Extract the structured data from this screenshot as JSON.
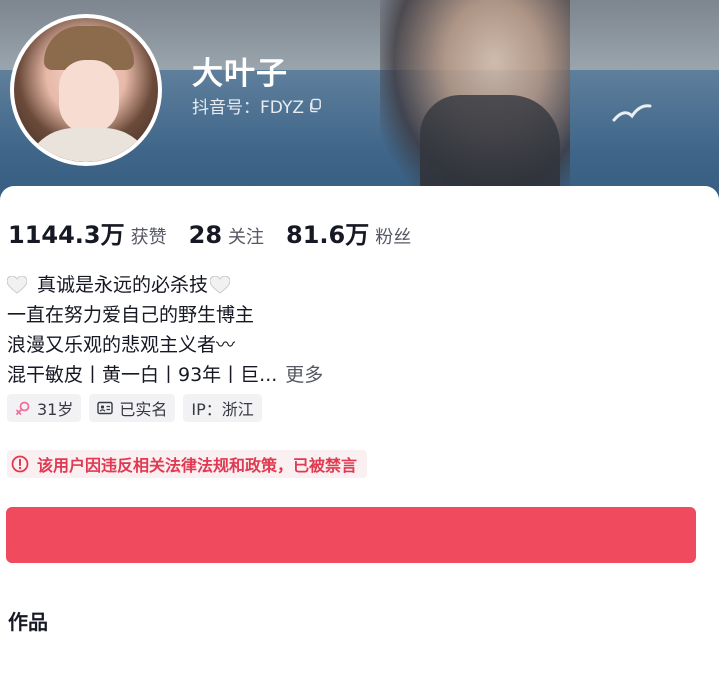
{
  "profile": {
    "name": "大叶子",
    "handle": "抖音号：FDYZ"
  },
  "stats": [
    {
      "value": "1144.3万",
      "label": "获赞"
    },
    {
      "value": "28",
      "label": "关注"
    },
    {
      "value": "81.6万",
      "label": "粉丝"
    }
  ],
  "bio": {
    "line1": "真诚是永远的必杀技",
    "line2": "一直在努力爱自己的野生博主",
    "line3": "浪漫又乐观的悲观主义者〰",
    "line4": "混干敏皮丨黄一白丨93年丨巨...",
    "more": "更多"
  },
  "tags": {
    "age": "31岁",
    "verified": "已实名",
    "ip": "IP：浙江"
  },
  "warning": "该用户因违反相关法律法规和政策，已被禁言",
  "sections": {
    "works": "作品"
  },
  "colors": {
    "accent": "#ef4a5e",
    "warning_text": "#e03a52",
    "warning_bg": "#fbf0f1"
  },
  "icons": [
    "copy-icon",
    "heart-icon",
    "female-icon",
    "id-card-icon",
    "alert-circle-icon"
  ]
}
